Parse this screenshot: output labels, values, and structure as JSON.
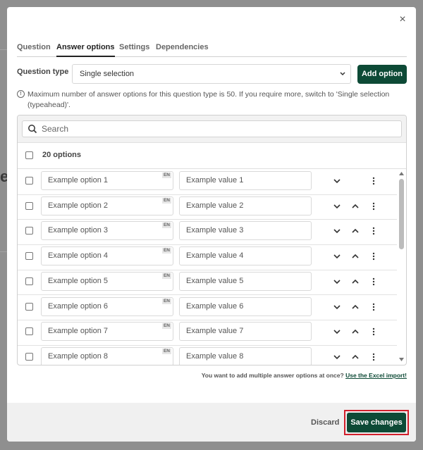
{
  "modal": {
    "close_symbol": "×",
    "tabs": [
      {
        "label": "Question",
        "active": false
      },
      {
        "label": "Answer options",
        "active": true
      },
      {
        "label": "Settings",
        "active": false
      },
      {
        "label": "Dependencies",
        "active": false
      }
    ]
  },
  "question_type": {
    "label": "Question type",
    "selected": "Single selection"
  },
  "add_option_label": "Add option",
  "info_text": "Maximum number of answer options for this question type is 50. If you require more, switch to 'Single selection (typeahead)'.",
  "search": {
    "placeholder": "Search"
  },
  "options_count_label": "20 options",
  "language_badge": "EN",
  "options": [
    {
      "label": "Example option 1",
      "value": "Example value 1"
    },
    {
      "label": "Example option 2",
      "value": "Example value 2"
    },
    {
      "label": "Example option 3",
      "value": "Example value 3"
    },
    {
      "label": "Example option 4",
      "value": "Example value 4"
    },
    {
      "label": "Example option 5",
      "value": "Example value 5"
    },
    {
      "label": "Example option 6",
      "value": "Example value 6"
    },
    {
      "label": "Example option 7",
      "value": "Example value 7"
    },
    {
      "label": "Example option 8",
      "value": "Example value 8"
    }
  ],
  "excel_note": {
    "text": "You want to add multiple answer options at once?",
    "link": "Use the Excel import!"
  },
  "footer": {
    "discard_label": "Discard",
    "save_label": "Save changes"
  },
  "colors": {
    "primary": "#0d4a36",
    "highlight": "#d01f2b",
    "overlay": "#8f8f8f"
  },
  "icons": [
    "close-icon",
    "info-icon",
    "search-icon",
    "chevron-down-icon",
    "chevron-up-icon",
    "more-vertical-icon",
    "scroll-up-icon",
    "scroll-down-icon"
  ]
}
